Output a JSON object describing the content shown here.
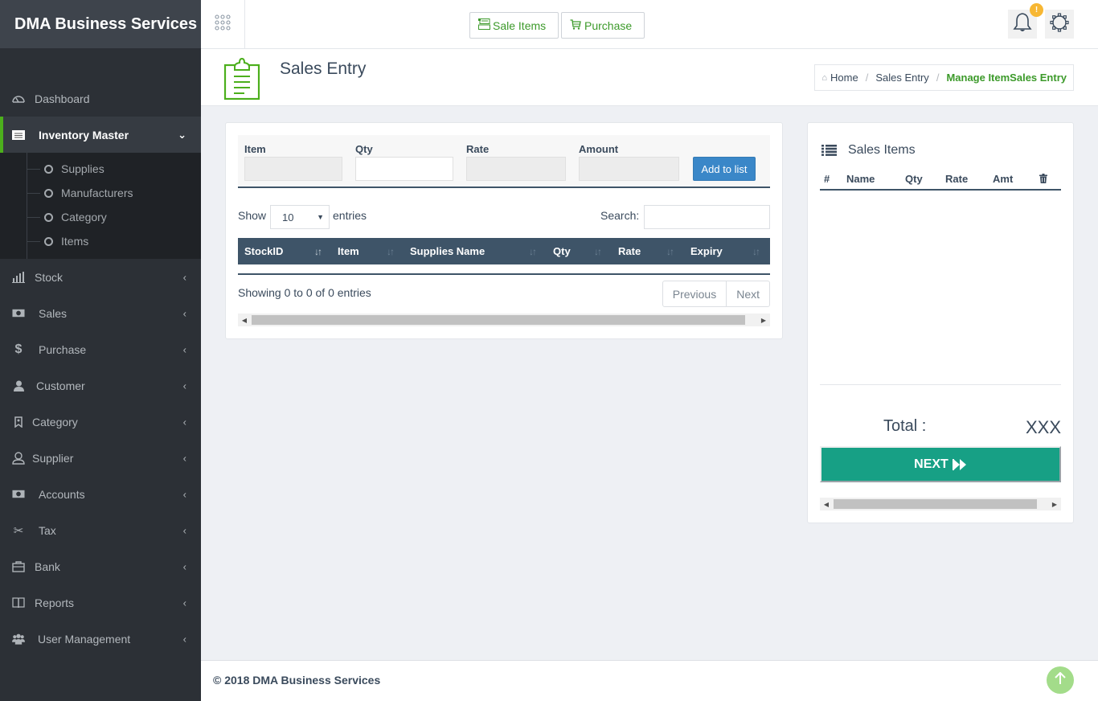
{
  "app": {
    "brand": "DMA Business Services"
  },
  "topbar": {
    "buttons": [
      {
        "label": "Sale Items",
        "icon": "register-icon"
      },
      {
        "label": "Purchase",
        "icon": "cart-icon"
      }
    ],
    "notification_badge": "!"
  },
  "sidebar": {
    "items": [
      {
        "label": "Dashboard",
        "icon": "dashboard-icon"
      },
      {
        "label": "Inventory Master",
        "icon": "inventory-icon",
        "expanded": true,
        "children": [
          "Supplies",
          "Manufacturers",
          "Category",
          "Items"
        ]
      },
      {
        "label": "Stock",
        "icon": "bar-chart-icon"
      },
      {
        "label": "Sales",
        "icon": "money-icon"
      },
      {
        "label": "Purchase",
        "icon": "dollar-icon"
      },
      {
        "label": "Customer",
        "icon": "user-icon"
      },
      {
        "label": "Category",
        "icon": "tag-icon"
      },
      {
        "label": "Supplier",
        "icon": "person-outline-icon"
      },
      {
        "label": "Accounts",
        "icon": "money-icon"
      },
      {
        "label": "Tax",
        "icon": "scissors-icon"
      },
      {
        "label": "Bank",
        "icon": "briefcase-icon"
      },
      {
        "label": "Reports",
        "icon": "book-icon"
      },
      {
        "label": "User Management",
        "icon": "users-icon"
      }
    ]
  },
  "page": {
    "title": "Sales Entry",
    "breadcrumb": [
      "Home",
      "Sales Entry",
      "Manage ItemSales Entry"
    ]
  },
  "entry_form": {
    "fields": [
      {
        "label": "Item",
        "value": ""
      },
      {
        "label": "Qty",
        "value": ""
      },
      {
        "label": "Rate",
        "value": ""
      },
      {
        "label": "Amount",
        "value": ""
      }
    ],
    "add_button": "Add to list"
  },
  "stock_table": {
    "show_label": "Show",
    "entries_label": "entries",
    "page_size": "10",
    "search_label": "Search:",
    "search_value": "",
    "columns": [
      "StockID",
      "Item",
      "Supplies Name",
      "Qty",
      "Rate",
      "Expiry"
    ],
    "rows": [],
    "info": "Showing 0 to 0 of 0 entries",
    "previous": "Previous",
    "next": "Next"
  },
  "sales_items": {
    "title": "Sales Items",
    "columns": [
      "#",
      "Name",
      "Qty",
      "Rate",
      "Amt"
    ],
    "rows": [],
    "total_label": "Total :",
    "total_value": "XXX",
    "next_button": "NEXT"
  },
  "footer": {
    "copyright": "© 2018 DMA Business Services"
  }
}
